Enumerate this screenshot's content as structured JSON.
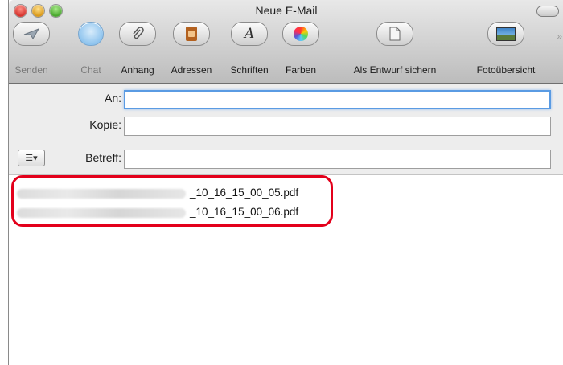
{
  "window": {
    "title": "Neue E-Mail"
  },
  "toolbar": {
    "send_label": "Senden",
    "chat_label": "Chat",
    "attach_label": "Anhang",
    "address_label": "Adressen",
    "fonts_label": "Schriften",
    "colors_label": "Farben",
    "draft_label": "Als Entwurf sichern",
    "photos_label": "Fotoübersicht"
  },
  "fields": {
    "to_label": "An:",
    "to_value": "",
    "cc_label": "Kopie:",
    "cc_value": "",
    "subject_label": "Betreff:",
    "subject_value": ""
  },
  "attachments": [
    {
      "name_suffix": "_10_16_15_00_05.pdf"
    },
    {
      "name_suffix": "_10_16_15_00_06.pdf"
    }
  ],
  "colors": {
    "highlight": "#e3001b",
    "focus": "#5a9be3"
  }
}
